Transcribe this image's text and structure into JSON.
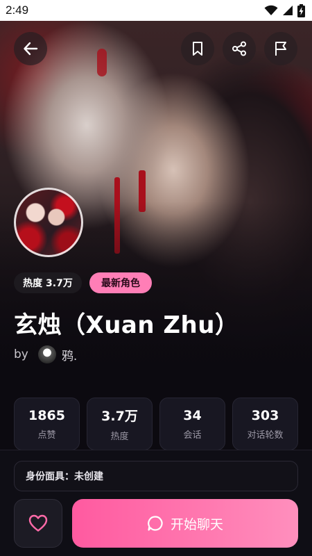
{
  "status_bar": {
    "time": "2:49",
    "icons": [
      "wifi-icon",
      "cellular-signal-icon",
      "battery-charging-icon"
    ]
  },
  "top_actions": {
    "back_icon": "arrow-left-icon",
    "bookmark_icon": "bookmark-icon",
    "share_icon": "share-icon",
    "report_icon": "flag-icon"
  },
  "character": {
    "tags": {
      "heat": "热度 3.7万",
      "latest": "最新角色"
    },
    "name": "玄烛（Xuan Zhu）",
    "author_prefix": "by",
    "author_name": "鸦."
  },
  "stats": [
    {
      "value": "1865",
      "label": "点赞"
    },
    {
      "value": "3.7万",
      "label": "热度"
    },
    {
      "value": "34",
      "label": "会话"
    },
    {
      "value": "303",
      "label": "对话轮数"
    }
  ],
  "persona": {
    "text": "身份面具：未创建"
  },
  "actions": {
    "like_icon": "heart-icon",
    "chat_label": "开始聊天",
    "chat_icon": "chat-bubble-icon"
  },
  "colors": {
    "accent_pink": "#ff6aa8",
    "tag_pink": "#ff7eb6",
    "background": "#0c0a10"
  }
}
